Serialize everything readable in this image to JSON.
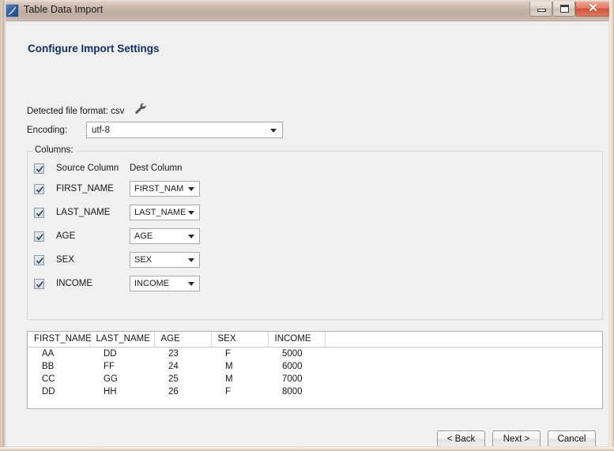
{
  "window": {
    "title": "Table Data Import",
    "app_icon": "dolphin-icon",
    "controls": {
      "minimize": "minimize-icon",
      "maximize": "maximize-icon",
      "close": "✕"
    }
  },
  "page": {
    "heading": "Configure Import Settings",
    "detected_label": "Detected file format: csv",
    "detected_settings_icon": "wrench-icon",
    "encoding_label": "Encoding:",
    "encoding_value": "utf-8"
  },
  "columns_group": {
    "legend": "Columns:",
    "header": {
      "checked": true,
      "source_label": "Source Column",
      "dest_label": "Dest Column"
    },
    "rows": [
      {
        "checked": true,
        "source": "FIRST_NAME",
        "dest": "FIRST_NAM"
      },
      {
        "checked": true,
        "source": "LAST_NAME",
        "dest": "LAST_NAME"
      },
      {
        "checked": true,
        "source": "AGE",
        "dest": "AGE"
      },
      {
        "checked": true,
        "source": "SEX",
        "dest": "SEX"
      },
      {
        "checked": true,
        "source": "INCOME",
        "dest": "INCOME"
      }
    ]
  },
  "preview": {
    "columns": [
      "FIRST_NAME",
      "LAST_NAME",
      "AGE",
      "SEX",
      "INCOME",
      ""
    ],
    "rows": [
      [
        "AA",
        "DD",
        "23",
        "F",
        "5000",
        ""
      ],
      [
        "BB",
        "FF",
        "24",
        "M",
        "6000",
        ""
      ],
      [
        "CC",
        "GG",
        "25",
        "M",
        "7000",
        ""
      ],
      [
        "DD",
        "HH",
        "26",
        "F",
        "8000",
        ""
      ]
    ]
  },
  "footer": {
    "back": "< Back",
    "next": "Next >",
    "cancel": "Cancel"
  },
  "colors": {
    "heading": "#0f2f6b",
    "titlebar_close": "#d0543a",
    "client_bg": "#f0f0f0"
  }
}
